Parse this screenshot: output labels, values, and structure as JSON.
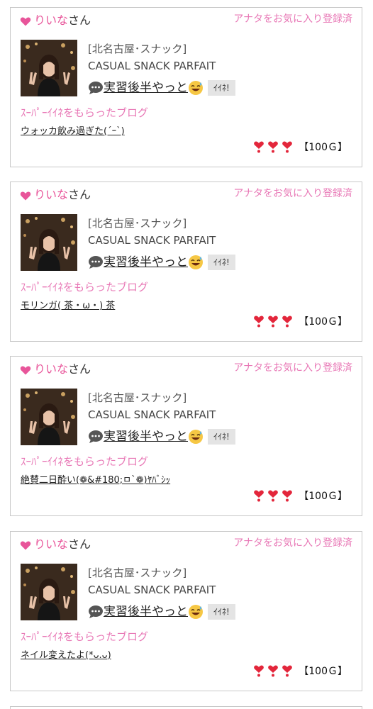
{
  "cards": [
    {
      "user_name": "りいな",
      "honorific": "さん",
      "fav_status": "アナタをお気に入り登録済",
      "shop_area": "[北名古屋･スナック]",
      "shop_name": "CASUAL SNACK PARFAIT",
      "message": "実習後半やっと",
      "iine_label": "ｲｲﾈ!",
      "super_label": "ｽｰﾊﾟｰｲｲﾈをもらったブログ",
      "blog_title": "ウォッカ飲み過ぎた(´ｰ`)",
      "hearts": 3,
      "price": "【100Ｇ】"
    },
    {
      "user_name": "りいな",
      "honorific": "さん",
      "fav_status": "アナタをお気に入り登録済",
      "shop_area": "[北名古屋･スナック]",
      "shop_name": "CASUAL SNACK PARFAIT",
      "message": "実習後半やっと",
      "iine_label": "ｲｲﾈ!",
      "super_label": "ｽｰﾊﾟｰｲｲﾈをもらったブログ",
      "blog_title": "モリンガ( 茶・ω・) 茶",
      "hearts": 3,
      "price": "【100Ｇ】"
    },
    {
      "user_name": "りいな",
      "honorific": "さん",
      "fav_status": "アナタをお気に入り登録済",
      "shop_area": "[北名古屋･スナック]",
      "shop_name": "CASUAL SNACK PARFAIT",
      "message": "実習後半やっと",
      "iine_label": "ｲｲﾈ!",
      "super_label": "ｽｰﾊﾟｰｲｲﾈをもらったブログ",
      "blog_title": "絶賛二日酔い(❁&#180;ㅁ`❁)ﾔﾊﾞｼｯ",
      "hearts": 3,
      "price": "【100Ｇ】"
    },
    {
      "user_name": "りいな",
      "honorific": "さん",
      "fav_status": "アナタをお気に入り登録済",
      "shop_area": "[北名古屋･スナック]",
      "shop_name": "CASUAL SNACK PARFAIT",
      "message": "実習後半やっと",
      "iine_label": "ｲｲﾈ!",
      "super_label": "ｽｰﾊﾟｰｲｲﾈをもらったブログ",
      "blog_title": "ネイル変えたよ(*ᴗ.ᴗ)",
      "hearts": 3,
      "price": "【100Ｇ】"
    }
  ],
  "colors": {
    "pink": "#e8559a",
    "light_pink": "#e878b6",
    "heart_red": "#e3263b",
    "border": "#c8c8c8"
  },
  "icons": {
    "name_heart": "heart-icon",
    "message": "speech-bubble-icon",
    "emoji": "sweat-smile-emoji-icon",
    "reward_heart": "exclamation-heart-icon"
  }
}
